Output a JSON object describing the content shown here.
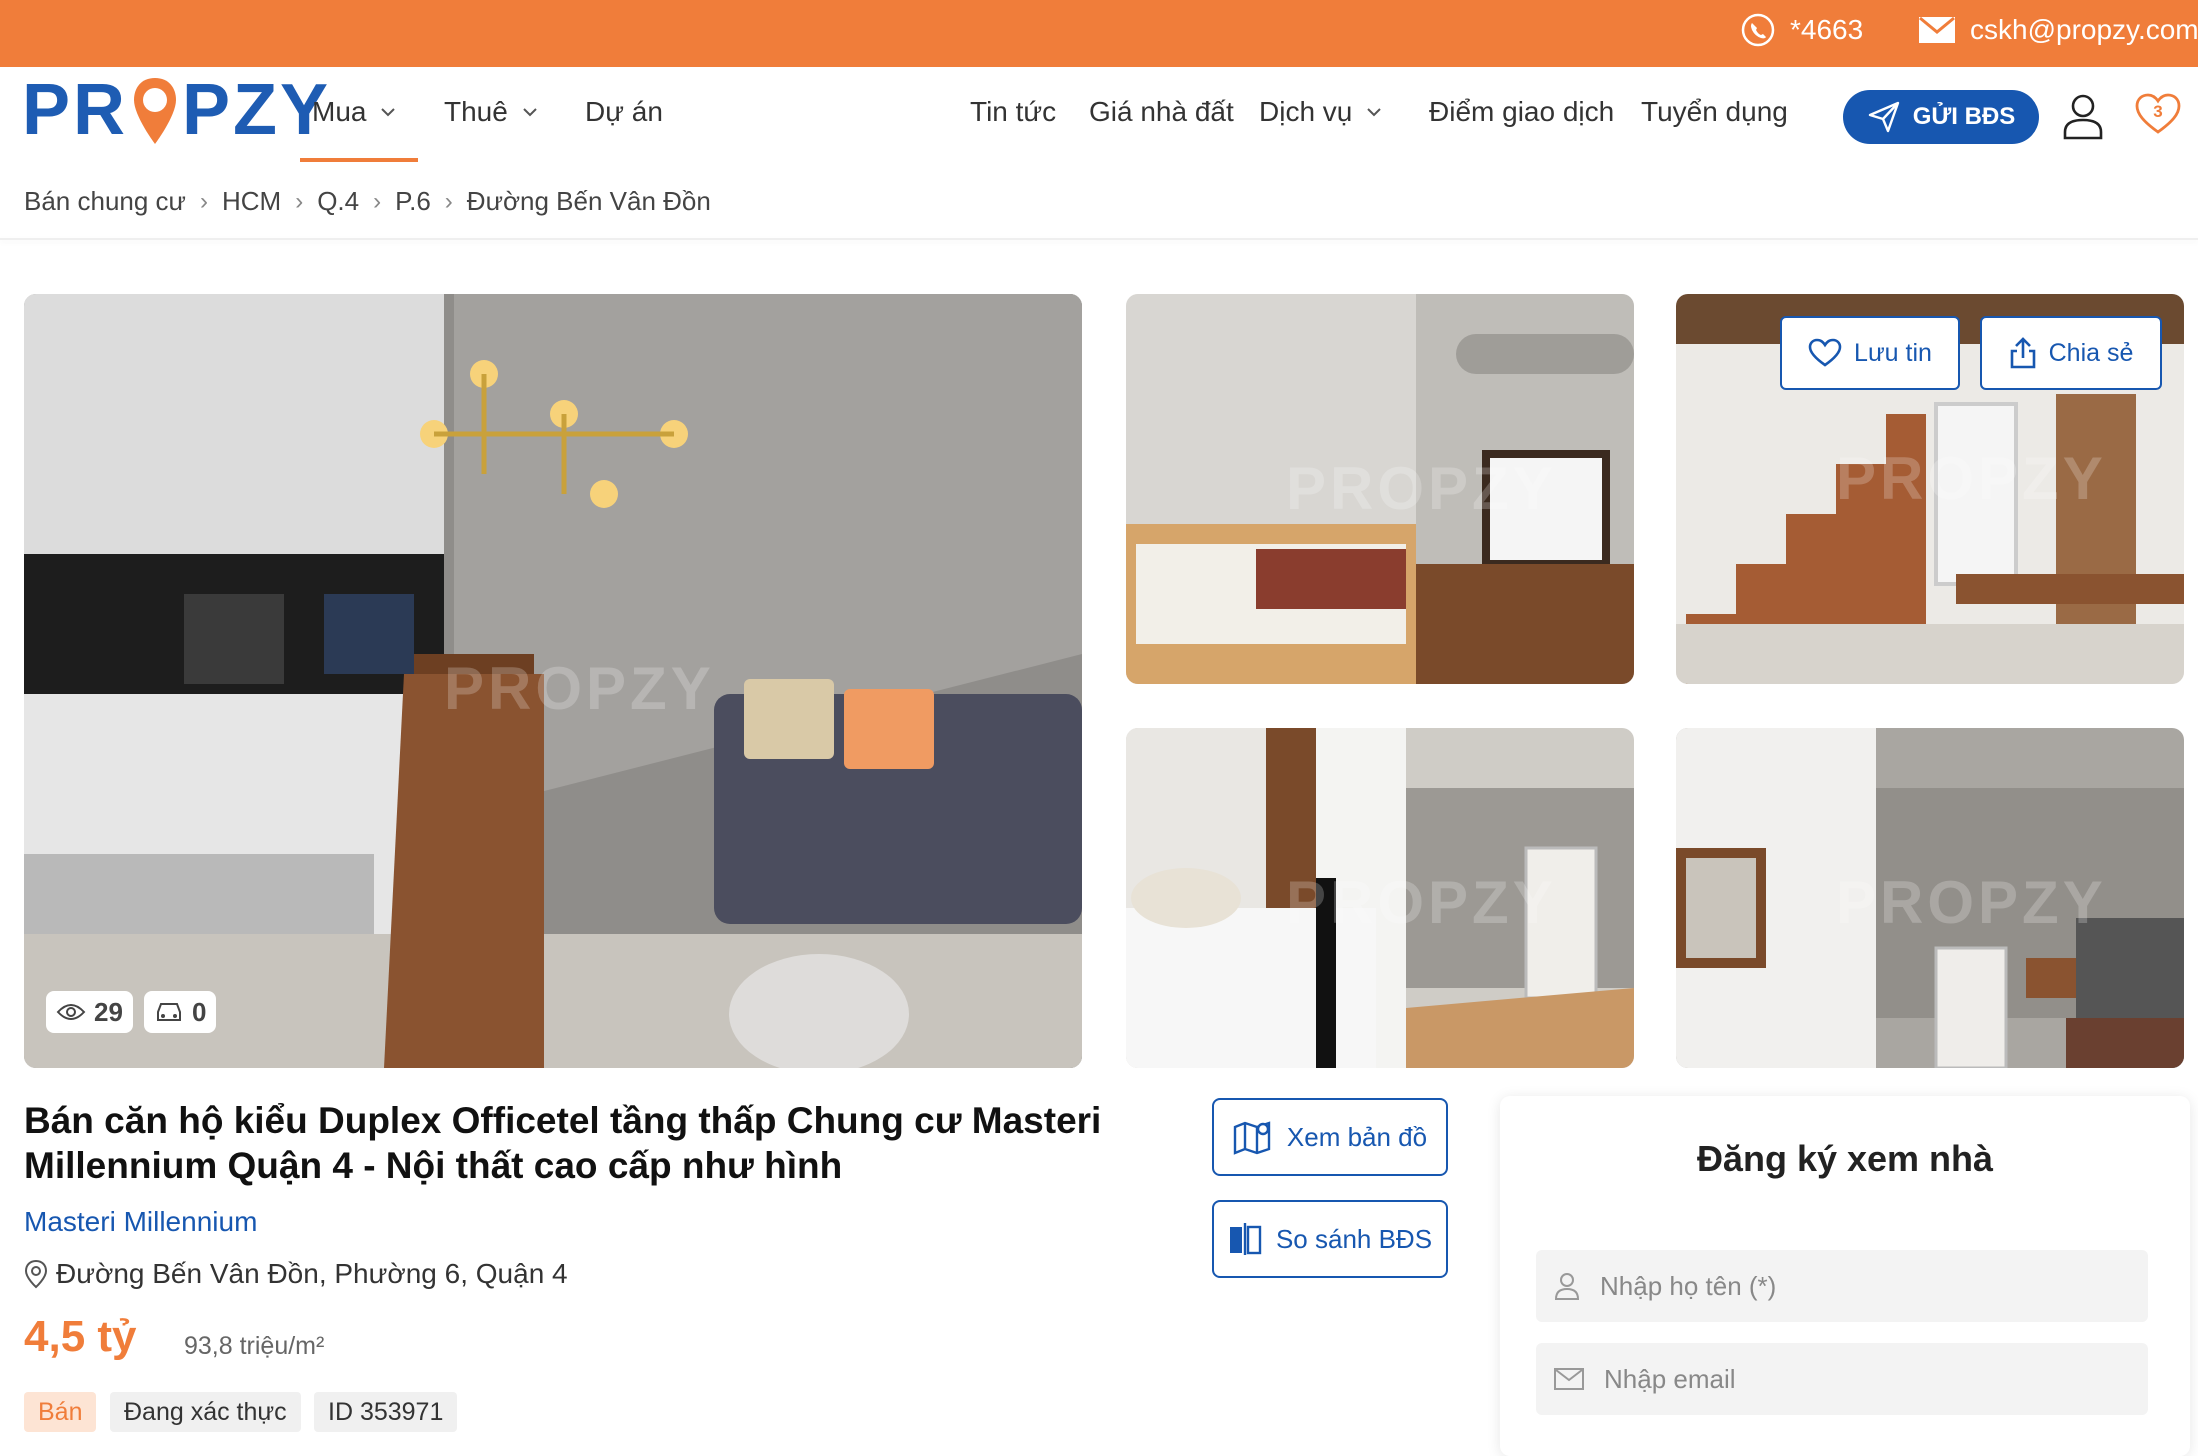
{
  "topbar": {
    "phone": "*4663",
    "email": "cskh@propzy.com"
  },
  "brand": {
    "logo_text": "PROPZY"
  },
  "nav": {
    "left": [
      {
        "label": "Mua",
        "dropdown": true
      },
      {
        "label": "Thuê",
        "dropdown": true
      },
      {
        "label": "Dự án",
        "dropdown": false
      }
    ],
    "right": [
      {
        "label": "Tin tức",
        "dropdown": false
      },
      {
        "label": "Giá nhà đất",
        "dropdown": false
      },
      {
        "label": "Dịch vụ",
        "dropdown": true
      },
      {
        "label": "Điểm giao dịch",
        "dropdown": false
      },
      {
        "label": "Tuyển dụng",
        "dropdown": false
      }
    ],
    "cta_label": "GỬI BĐS",
    "favorites_count": "3"
  },
  "breadcrumb": [
    "Bán chung cư",
    "HCM",
    "Q.4",
    "P.6",
    "Đường Bến Vân Đồn"
  ],
  "gallery": {
    "watermark": "PROPZY",
    "views": "29",
    "cars": "0",
    "save_label": "Lưu tin",
    "share_label": "Chia sẻ"
  },
  "listing": {
    "title": "Bán căn hộ kiểu Duplex Officetel tầng thấp Chung cư Masteri Millennium Quận 4 - Nội thất cao cấp như hình",
    "project": "Masteri Millennium",
    "address": "Đường Bến Vân Đồn, Phường 6, Quận 4",
    "price": "4,5 tỷ",
    "price_per_m2": "93,8 triệu/m²",
    "tags": [
      "Bán",
      "Đang xác thực",
      "ID 353971"
    ]
  },
  "actions": {
    "map_label": "Xem bản đồ",
    "compare_label": "So sánh BĐS"
  },
  "form": {
    "title": "Đăng ký xem nhà",
    "name_placeholder": "Nhập họ tên (*)",
    "email_placeholder": "Nhập email"
  },
  "colors": {
    "brand_orange": "#f07d3a",
    "brand_blue": "#1757b0"
  }
}
